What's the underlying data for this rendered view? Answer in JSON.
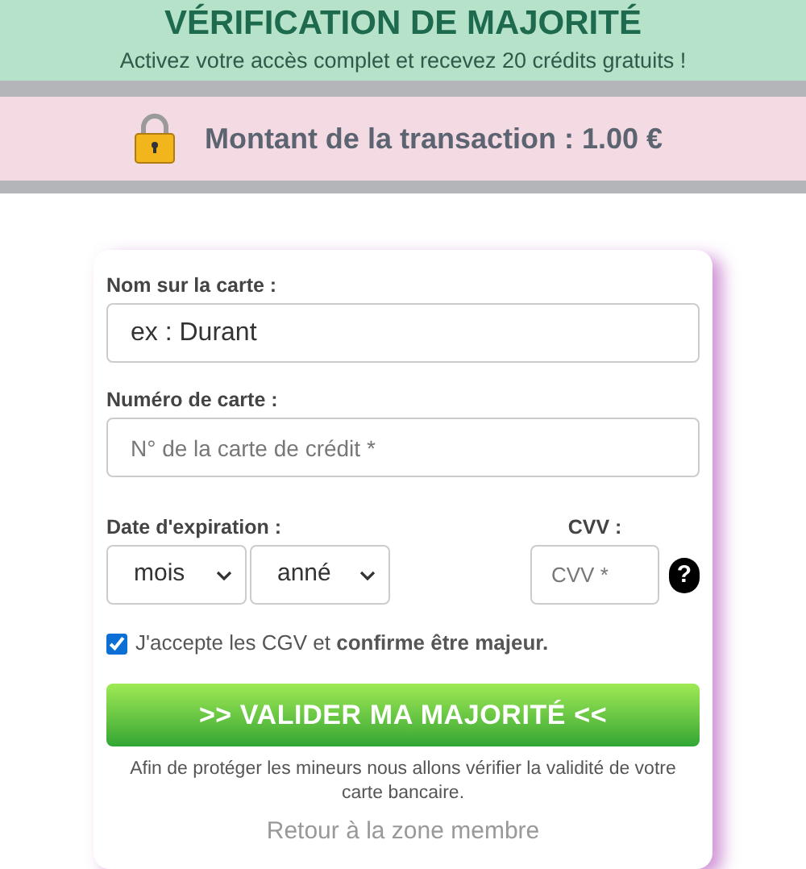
{
  "header": {
    "title": "VÉRIFICATION DE MAJORITÉ",
    "subtitle": "Activez votre accès complet et recevez 20 crédits gratuits !"
  },
  "transaction": {
    "label": "Montant de la transaction : ",
    "amount": "1.00 €"
  },
  "form": {
    "name": {
      "label": "Nom sur la carte :",
      "value": "ex : Durant"
    },
    "number": {
      "label": "Numéro de carte :",
      "placeholder": "N° de la carte de crédit *"
    },
    "expiry": {
      "label": "Date d'expiration :",
      "month": "mois",
      "year": "anné"
    },
    "cvv": {
      "label": "CVV :",
      "placeholder": "CVV *",
      "help": "?"
    },
    "consent": {
      "text": "J'accepte les CGV et **confirme être majeur.**",
      "checked": true
    },
    "submit": ">> VALIDER MA MAJORITÉ <<",
    "note": "Afin de protéger les mineurs nous allons vérifier la validité de votre carte bancaire.",
    "back_link": "Retour à la zone membre"
  }
}
